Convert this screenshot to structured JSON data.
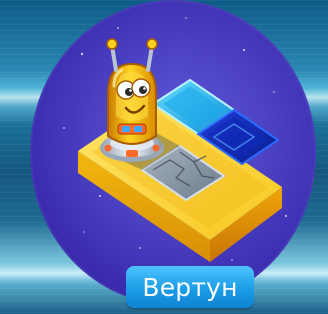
{
  "card": {
    "caption": "Вертун",
    "accent_color": "#1a9de8",
    "badge_color": "#4a3fc4"
  },
  "scene": {
    "robot_icon": "robot-vertun-icon",
    "tiles": [
      "blue-glow-tile",
      "dark-blue-crystal-tile",
      "cracked-stone-tile",
      "yellow-platform"
    ]
  }
}
